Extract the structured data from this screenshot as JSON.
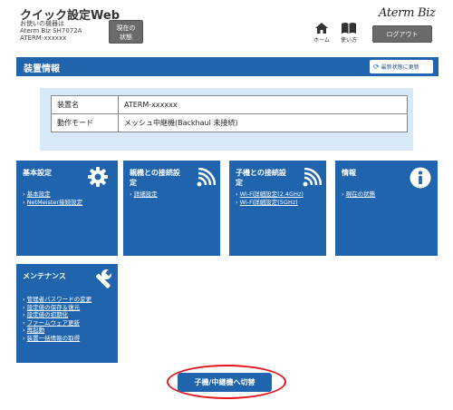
{
  "header": {
    "app_title": "クイック設定Web",
    "device_lines": [
      "お使いの機器は",
      "Aterm Biz SH7072A",
      "ATERM-xxxxxx"
    ],
    "status_button_lines": [
      "現在の",
      "状態"
    ],
    "home_label": "ホーム",
    "help_label": "使い方",
    "brand": "Aterm Biz",
    "logout_label": "ログアウト"
  },
  "device_info": {
    "title": "装置情報",
    "refresh_label": "最新状態に更新",
    "rows": [
      {
        "key": "装置名",
        "value": "ATERM-xxxxxx"
      },
      {
        "key": "動作モード",
        "value": "メッシュ中継機(Backhaul 未接続)"
      }
    ]
  },
  "cards": {
    "basic": {
      "title": "基本設定",
      "icon": "gear-icon",
      "links": [
        "基本設定",
        "NetMeister接続設定"
      ]
    },
    "parent": {
      "title_lines": [
        "親機との接続設",
        "定"
      ],
      "icon": "wifi-icon",
      "links": [
        "詳細設定"
      ]
    },
    "child": {
      "title_lines": [
        "子機との接続設",
        "定"
      ],
      "icon": "wifi-icon",
      "links": [
        "Wi-Fi詳細設定(2.4GHz)",
        "Wi-Fi詳細設定(5GHz)"
      ]
    },
    "info": {
      "title": "情報",
      "icon": "info-icon",
      "links": [
        "現在の状態"
      ]
    },
    "maintenance": {
      "title": "メンテナンス",
      "icon": "wrench-icon",
      "links": [
        "管理者パスワードの変更",
        "設定値の保存＆復元",
        "設定値の初期化",
        "ファームウェア更新",
        "再起動",
        "装置一括情報の取得"
      ]
    }
  },
  "switch_button_label": "子機/中継機へ切替",
  "colors": {
    "primary": "#1f64ad",
    "panel": "#d7e8f8",
    "button_gray": "#6a6a6a",
    "highlight_ring": "#e5141a"
  }
}
